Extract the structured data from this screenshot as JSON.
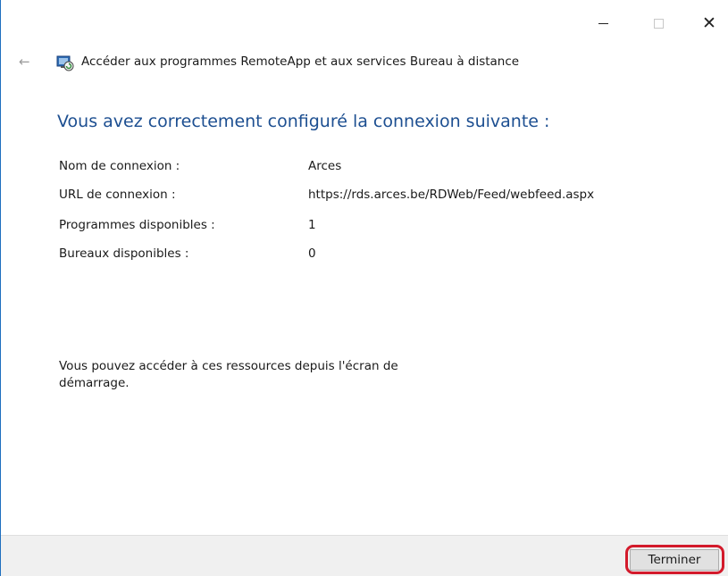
{
  "window": {
    "controls": {
      "minimize_icon": "minimize-icon",
      "maximize_icon": "maximize-icon",
      "close_icon": "close-icon"
    }
  },
  "header": {
    "back_icon": "back-arrow-icon",
    "app_icon": "remoteapp-icon",
    "title": "Accéder aux programmes RemoteApp et aux services Bureau à distance"
  },
  "main": {
    "heading": "Vous avez correctement configuré la connexion suivante :",
    "details": [
      {
        "label": "Nom de connexion :",
        "value": "Arces"
      },
      {
        "label": "URL de connexion :",
        "value": "https://rds.arces.be/RDWeb/Feed/webfeed.aspx"
      },
      {
        "label": "Programmes disponibles :",
        "value": "1"
      },
      {
        "label": "Bureaux disponibles :",
        "value": "0"
      }
    ],
    "info": "Vous pouvez accéder à ces ressources depuis l'écran de démarrage."
  },
  "footer": {
    "finish_label": "Terminer",
    "highlight_color": "#d31a2b"
  },
  "colors": {
    "heading": "#1d4f91",
    "footer_bg": "#f0f0f0"
  }
}
